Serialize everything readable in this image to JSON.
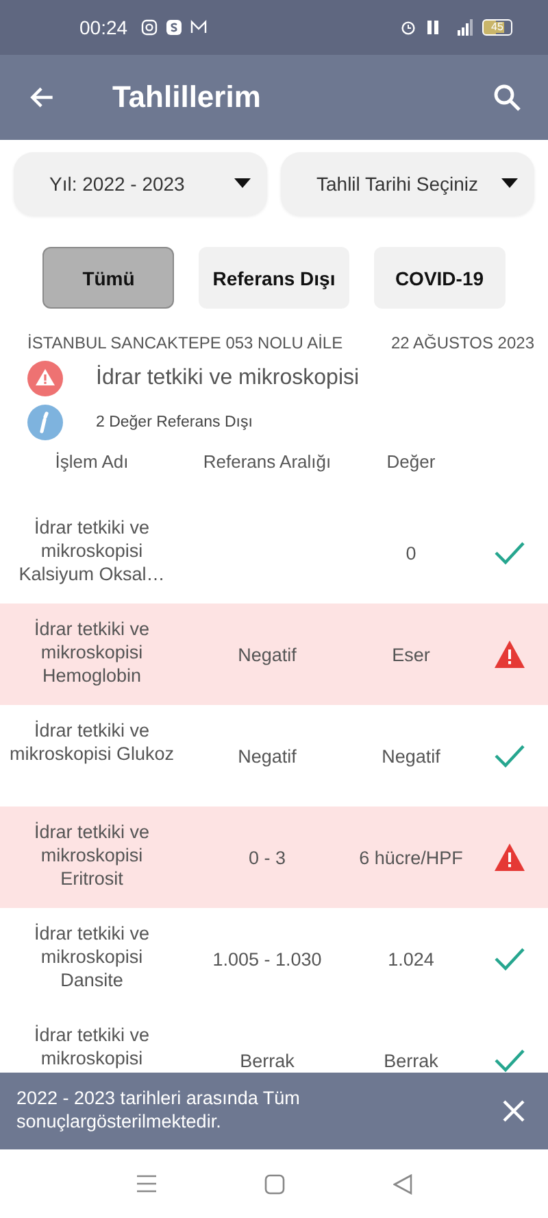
{
  "status_bar": {
    "time": "00:24",
    "battery": "45"
  },
  "app_bar": {
    "title": "Tahlillerim"
  },
  "filters": [
    {
      "label": "Yıl: 2022 - 2023"
    },
    {
      "label": "Tahlil Tarihi Seçiniz"
    }
  ],
  "tabs": [
    {
      "label": "Tümü",
      "selected": true
    },
    {
      "label": "Referans Dışı",
      "selected": false
    },
    {
      "label": "COVID-19",
      "selected": false
    }
  ],
  "report": {
    "facility": "İSTANBUL SANCAKTEPE 053 NOLU AİLE",
    "date": "22 AĞUSTOS 2023",
    "test_name": "İdrar tetkiki ve mikroskopisi",
    "summary": "2 Değer Referans Dışı"
  },
  "table": {
    "columns": [
      "İşlem Adı",
      "Referans Aralığı",
      "Değer"
    ],
    "rows": [
      {
        "name": "İdrar tetkiki ve mikroskopisi Kalsiyum Oksal…",
        "value": "0",
        "out_of_range": false
      },
      {
        "name": "İdrar tetkiki ve mikroskopisi Hemoglobin",
        "range": "Negatif",
        "value": "Eser",
        "out_of_range": true
      },
      {
        "name": "İdrar tetkiki ve mikroskopisi Glukoz",
        "range": "Negatif",
        "value": "Negatif",
        "out_of_range": false
      },
      {
        "name": "İdrar tetkiki ve mikroskopisi Eritrosit",
        "range": "0 - 3",
        "value": "6 hücre/HPF",
        "out_of_range": true
      },
      {
        "name": "İdrar tetkiki ve mikroskopisi Dansite",
        "range": "1.005 - 1.030",
        "value": "1.024",
        "out_of_range": false
      },
      {
        "name": "İdrar tetkiki ve mikroskopisi",
        "range": "Berrak",
        "value": "Berrak",
        "out_of_range": false
      }
    ]
  },
  "snackbar": {
    "message": "2022 - 2023 tarihleri arasında Tüm sonuçlargösterilmektedir."
  }
}
